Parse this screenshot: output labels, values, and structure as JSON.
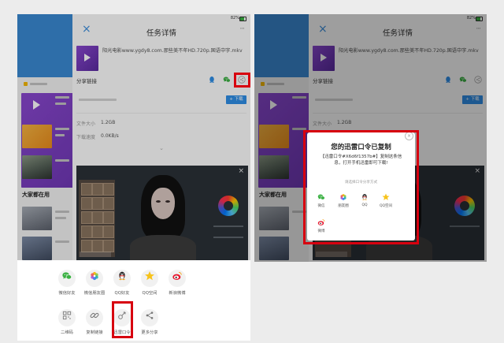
{
  "status_bar": {
    "battery": "82%"
  },
  "task": {
    "title": "任务详情",
    "file_name": "阳光电影www.ygdy8.com.那些美不年HD.720p.国语中字.mkv",
    "share_link_label": "分享链接",
    "download_button": "+ 下载",
    "file_size_label": "文件大小",
    "file_size": "1.2GB",
    "speed_label": "下载速度",
    "speed": "0.0KB/s"
  },
  "background_app": {
    "section_title": "大家都在用"
  },
  "share_sheet": {
    "row1": [
      {
        "label": "微信好友",
        "icon": "wechat-icon"
      },
      {
        "label": "微信朋友圈",
        "icon": "moments-icon"
      },
      {
        "label": "QQ好友",
        "icon": "qq-icon"
      },
      {
        "label": "QQ空间",
        "icon": "qzone-icon"
      },
      {
        "label": "新浪微博",
        "icon": "weibo-icon"
      }
    ],
    "row2": [
      {
        "label": "二维码",
        "icon": "qrcode-icon"
      },
      {
        "label": "复制链接",
        "icon": "link-icon"
      },
      {
        "label": "迅雷口令",
        "icon": "key-icon"
      },
      {
        "label": "更多分享",
        "icon": "share-icon"
      }
    ]
  },
  "dialog": {
    "title": "您的迅雷口令已复制",
    "message": "【迅雷口令#X6d6f1357b#】复制这条信息，打开手机迅雷即可下载!",
    "prompt": "请选择口令分享方式",
    "options": [
      {
        "label": "微信",
        "icon": "wechat-icon"
      },
      {
        "label": "朋友圈",
        "icon": "moments-icon"
      },
      {
        "label": "QQ",
        "icon": "qq-icon"
      },
      {
        "label": "QQ空间",
        "icon": "qzone-icon"
      },
      {
        "label": "微博",
        "icon": "weibo-icon"
      }
    ]
  },
  "colors": {
    "highlight": "#d7000f",
    "accent": "#2f8fe8",
    "wechat": "#3bb143"
  }
}
